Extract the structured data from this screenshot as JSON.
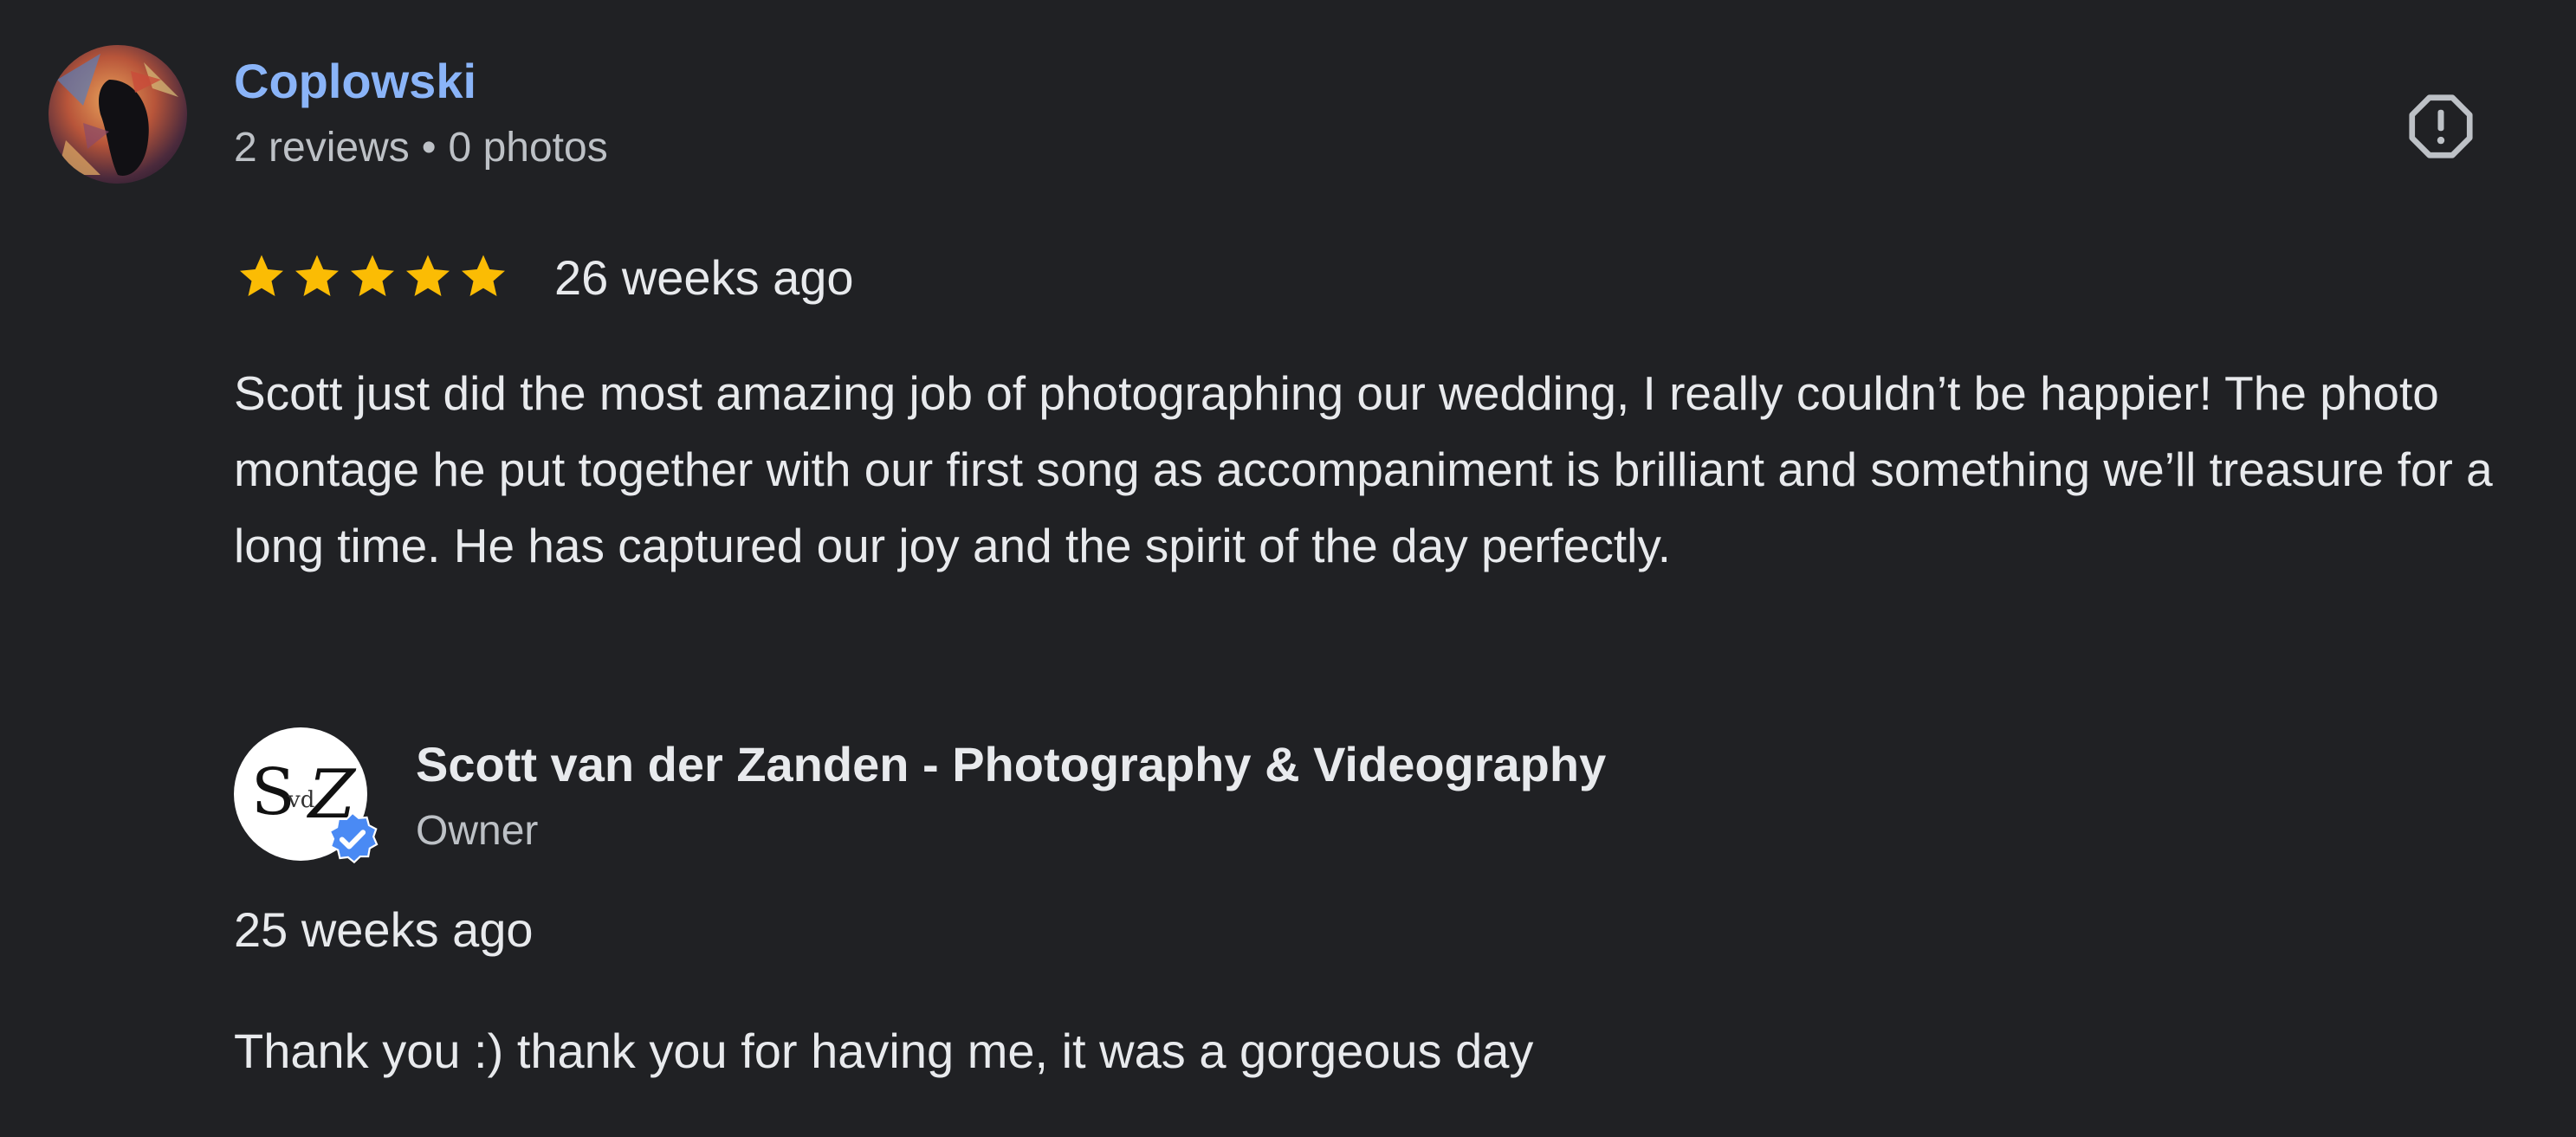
{
  "reviewer": {
    "name": "Coplowski",
    "reviews": "2 reviews",
    "separator": "•",
    "photos": "0 photos",
    "avatar_icon": "user-avatar"
  },
  "report": {
    "icon": "report-icon"
  },
  "review": {
    "rating": 5,
    "max_rating": 5,
    "date": "26 weeks ago",
    "text": "Scott just did the most amazing job of photographing our wedding, I really couldn’t be happier! The photo montage he put together with our first song as accompaniment is brilliant and something we’ll treasure for a long time. He has captured our joy and the spirit of the day perfectly."
  },
  "owner_reply": {
    "name": "Scott van der Zanden - Photography & Videography",
    "role": "Owner",
    "logo_text": "SvdZ",
    "badge_icon": "verified-icon",
    "date": "25 weeks ago",
    "text": "Thank you :) thank you for having me, it was a gorgeous day"
  },
  "colors": {
    "background": "#202124",
    "name_link": "#8ab4f8",
    "primary_text": "#e8eaed",
    "secondary_text": "#bdc1c6",
    "star": "#fbbc04",
    "verified": "#4a8af4"
  }
}
